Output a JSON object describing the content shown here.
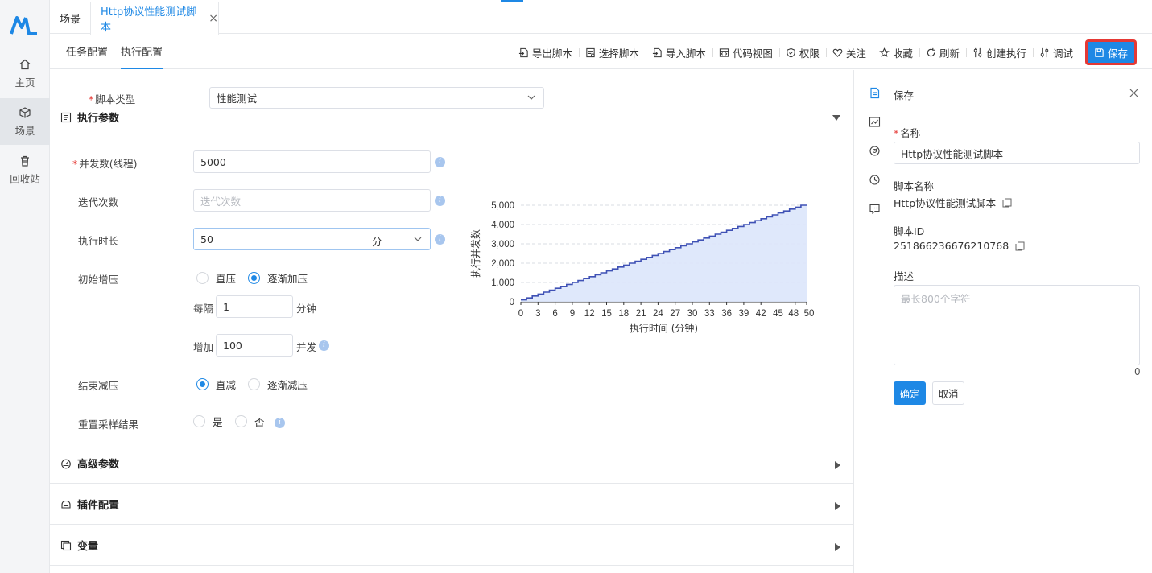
{
  "sidebar": {
    "items": [
      {
        "label": "主页",
        "icon": "home-icon"
      },
      {
        "label": "场景",
        "icon": "cube-icon"
      },
      {
        "label": "回收站",
        "icon": "trash-icon"
      }
    ]
  },
  "tabs": {
    "home": "场景",
    "active": "Http协议性能测试脚本",
    "close": "×"
  },
  "subnav": {
    "tabs": [
      "任务配置",
      "执行配置"
    ],
    "active_index": 1
  },
  "toolbar": {
    "items": [
      "导出脚本",
      "选择脚本",
      "导入脚本",
      "代码视图",
      "权限",
      "关注",
      "收藏",
      "刷新",
      "创建执行",
      "调试"
    ],
    "save": "保存"
  },
  "form": {
    "script_type_label": "脚本类型",
    "script_type_value": "性能测试",
    "exec_params_title": "执行参数",
    "threads_label": "并发数(线程)",
    "threads_value": "5000",
    "iterations_label": "迭代次数",
    "iterations_placeholder": "迭代次数",
    "duration_label": "执行时长",
    "duration_value": "50",
    "duration_unit": "分",
    "ramp_up_label": "初始增压",
    "ramp_up_options": [
      "直压",
      "逐渐加压"
    ],
    "ramp_up_selected": 1,
    "every_label": "每隔",
    "every_value": "1",
    "every_unit": "分钟",
    "increase_label": "增加",
    "increase_value": "100",
    "increase_unit": "并发",
    "ramp_down_label": "结束减压",
    "ramp_down_options": [
      "直减",
      "逐渐减压"
    ],
    "ramp_down_selected": 0,
    "reset_label": "重置采样结果",
    "reset_options": [
      "是",
      "否"
    ],
    "info_glyph": "i"
  },
  "sections": [
    {
      "title": "高级参数",
      "icon": "gauge-icon"
    },
    {
      "title": "插件配置",
      "icon": "plugin-icon"
    },
    {
      "title": "变量",
      "icon": "variable-icon"
    }
  ],
  "chart_data": {
    "type": "area",
    "xlabel": "执行时间 (分钟)",
    "ylabel": "执行并发数",
    "x_ticks": [
      "0",
      "3",
      "6",
      "9",
      "12",
      "15",
      "18",
      "21",
      "24",
      "27",
      "30",
      "33",
      "36",
      "39",
      "42",
      "45",
      "48",
      "50"
    ],
    "y_ticks": [
      "0",
      "1,000",
      "2,000",
      "3,000",
      "4,000",
      "5,000"
    ],
    "xlim": [
      0,
      50
    ],
    "ylim": [
      0,
      5000
    ],
    "step_interval_minutes": 1,
    "step_increase": 100,
    "max_concurrency": 5000,
    "series": [
      {
        "x": [
          0,
          1,
          2,
          3,
          4,
          5,
          6,
          7,
          8,
          9,
          10,
          11,
          12,
          13,
          14,
          15,
          16,
          17,
          18,
          19,
          20,
          21,
          22,
          23,
          24,
          25,
          26,
          27,
          28,
          29,
          30,
          31,
          32,
          33,
          34,
          35,
          36,
          37,
          38,
          39,
          40,
          41,
          42,
          43,
          44,
          45,
          46,
          47,
          48,
          49,
          50
        ],
        "y": [
          100,
          200,
          300,
          400,
          500,
          600,
          700,
          800,
          900,
          1000,
          1100,
          1200,
          1300,
          1400,
          1500,
          1600,
          1700,
          1800,
          1900,
          2000,
          2100,
          2200,
          2300,
          2400,
          2500,
          2600,
          2700,
          2800,
          2900,
          3000,
          3100,
          3200,
          3300,
          3400,
          3500,
          3600,
          3700,
          3800,
          3900,
          4000,
          4100,
          4200,
          4300,
          4400,
          4500,
          4600,
          4700,
          4800,
          4900,
          5000,
          5000
        ]
      }
    ],
    "grid": true,
    "colors": {
      "line": "#3f51b5",
      "fill": "#dbe6fb",
      "grid": "#d9dde3"
    }
  },
  "panel": {
    "title": "保存",
    "name_label": "名称",
    "name_value": "Http协议性能测试脚本",
    "script_name_label": "脚本名称",
    "script_name_value": "Http协议性能测试脚本",
    "script_id_label": "脚本ID",
    "script_id_value": "251866236676210768",
    "desc_label": "描述",
    "desc_placeholder": "最长800个字符",
    "desc_count": "0",
    "confirm": "确定",
    "cancel": "取消"
  },
  "colors": {
    "accent": "#1e88e5",
    "highlight_border": "#e53935"
  }
}
